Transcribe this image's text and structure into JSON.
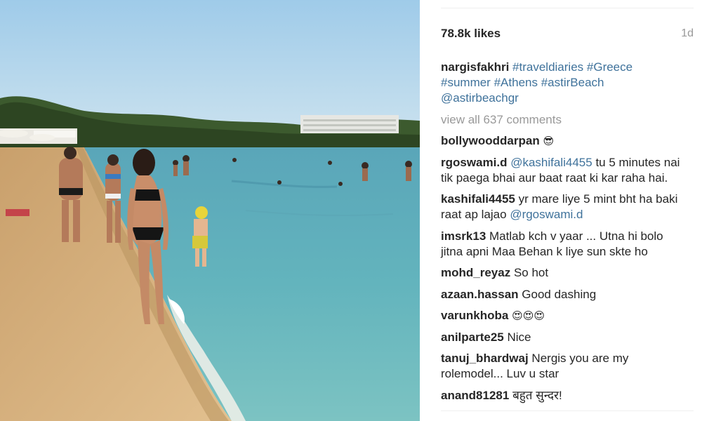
{
  "post": {
    "likes": "78.8k likes",
    "time_ago": "1d",
    "caption": {
      "username": "nargisfakhri",
      "tags": [
        "#traveldiaries",
        "#Greece",
        "#summer",
        "#Athens",
        "#astirBeach",
        "@astirbeachgr"
      ]
    },
    "view_all": "view all 637 comments",
    "comments": [
      {
        "user": "bollywooddarpan",
        "mention": "",
        "text": "😎"
      },
      {
        "user": "rgoswami.d",
        "mention": "@kashifali4455",
        "text": "tu 5 minutes nai tik paega bhai aur baat raat ki kar raha hai."
      },
      {
        "user": "kashifali4455",
        "mention": "",
        "text": "yr mare liye 5 mint bht ha baki raat ap lajao",
        "trailing_mention": "@rgoswami.d"
      },
      {
        "user": "imsrk13",
        "mention": "",
        "text": "Matlab kch v yaar ... Utna hi bolo jitna apni Maa Behan k liye sun skte ho"
      },
      {
        "user": "mohd_reyaz",
        "mention": "",
        "text": "So hot"
      },
      {
        "user": "azaan.hassan",
        "mention": "",
        "text": "Good dashing"
      },
      {
        "user": "varunkhoba",
        "mention": "",
        "text": "😍😍😍"
      },
      {
        "user": "anilparte25",
        "mention": "",
        "text": "Nice"
      },
      {
        "user": "tanuj_bhardwaj",
        "mention": "",
        "text": "Nergis you are my rolemodel... Luv u star"
      },
      {
        "user": "anand81281",
        "mention": "",
        "text": "बहुत सुन्दर!"
      }
    ]
  },
  "photo": {
    "icon": "beach-photo",
    "colors": {
      "sky": "#a9d3ec",
      "sea": "#4aa9b8",
      "sand": "#d9b27f",
      "trees": "#2f4b26"
    }
  }
}
